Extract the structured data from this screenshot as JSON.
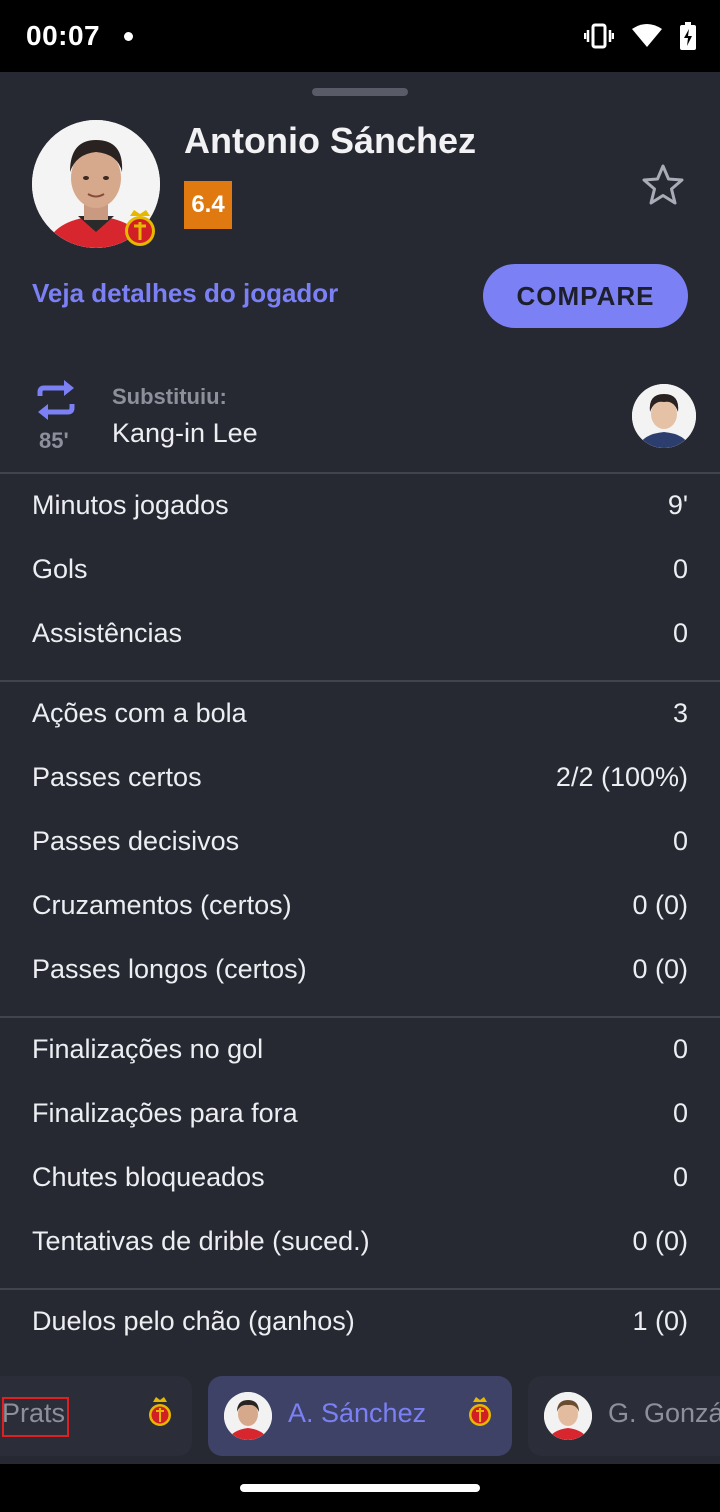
{
  "status_bar": {
    "time": "00:07"
  },
  "player": {
    "name": "Antonio Sánchez",
    "rating": "6.4",
    "details_link": "Veja detalhes do jogador",
    "compare_label": "COMPARE"
  },
  "substitution": {
    "minute": "85'",
    "label": "Substituiu:",
    "name": "Kang-in Lee"
  },
  "stats": [
    {
      "label": "Minutos jogados",
      "value": "9'"
    },
    {
      "label": "Gols",
      "value": "0"
    },
    {
      "label": "Assistências",
      "value": "0"
    },
    {
      "label": "Ações com a bola",
      "value": "3"
    },
    {
      "label": "Passes certos",
      "value": "2/2 (100%)"
    },
    {
      "label": "Passes decisivos",
      "value": "0"
    },
    {
      "label": "Cruzamentos (certos)",
      "value": "0 (0)"
    },
    {
      "label": "Passes longos (certos)",
      "value": "0 (0)"
    },
    {
      "label": "Finalizações no gol",
      "value": "0"
    },
    {
      "label": "Finalizações para fora",
      "value": "0"
    },
    {
      "label": "Chutes bloqueados",
      "value": "0"
    },
    {
      "label": "Tentativas de drible (suced.)",
      "value": "0 (0)"
    },
    {
      "label": "Duelos pelo chão (ganhos)",
      "value": "1 (0)"
    }
  ],
  "player_tabs": [
    {
      "label": "Prats"
    },
    {
      "label": "A. Sánchez"
    },
    {
      "label": "G. Gonzá"
    }
  ],
  "colors": {
    "accent": "#7b80f5",
    "rating": "#e07a10",
    "background": "#262932"
  }
}
